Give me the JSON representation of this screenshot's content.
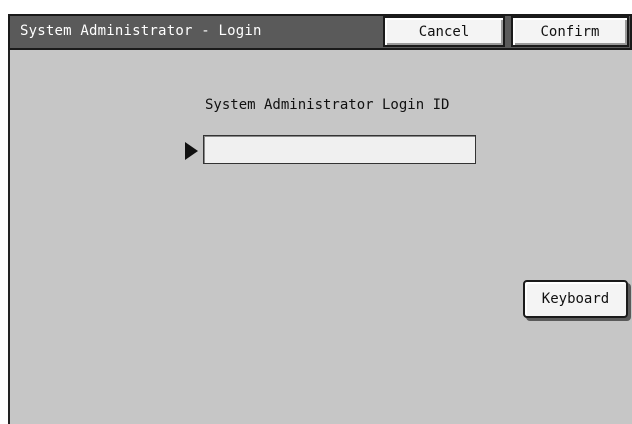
{
  "header": {
    "title": "System Administrator - Login",
    "cancel_label": "Cancel",
    "confirm_label": "Confirm"
  },
  "login": {
    "field_label": "System Administrator Login ID",
    "value": ""
  },
  "keyboard": {
    "label": "Keyboard"
  },
  "colors": {
    "titlebar_bg": "#5a5a5a",
    "panel_bg": "#c6c6c6",
    "button_bg": "#f4f4f4"
  }
}
